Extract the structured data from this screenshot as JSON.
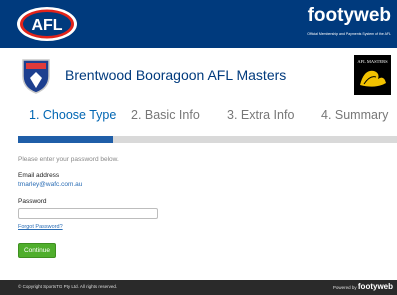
{
  "header": {
    "afl_logo_text": "AFL",
    "brand_name": "footyweb",
    "brand_tagline": "Official Membership and Payments System of the AFL"
  },
  "club": {
    "title": "Brentwood Booragoon AFL Masters",
    "masters_logo_text": "AFL MASTERS"
  },
  "steps": [
    {
      "label": "1. Choose Type",
      "active": true
    },
    {
      "label": "2. Basic Info",
      "active": false
    },
    {
      "label": "3. Extra Info",
      "active": false
    },
    {
      "label": "4. Summary",
      "active": false
    }
  ],
  "progress": {
    "fraction": 0.25
  },
  "form": {
    "intro": "Please enter your password below.",
    "email_label": "Email address",
    "email_value": "tmarley@wafc.com.au",
    "password_label": "Password",
    "password_value": "",
    "forgot_label": "Forgot Password?",
    "continue_label": "Continue"
  },
  "footer": {
    "copyright": "© Copyright SportsTG Pty Ltd. All rights reserved.",
    "powered_prefix": "Powered by",
    "powered_brand": "footyweb"
  },
  "colors": {
    "header_bg": "#003a7d",
    "accent": "#0066b3",
    "button": "#4fae2c",
    "footer_bg": "#2a2a2a"
  }
}
